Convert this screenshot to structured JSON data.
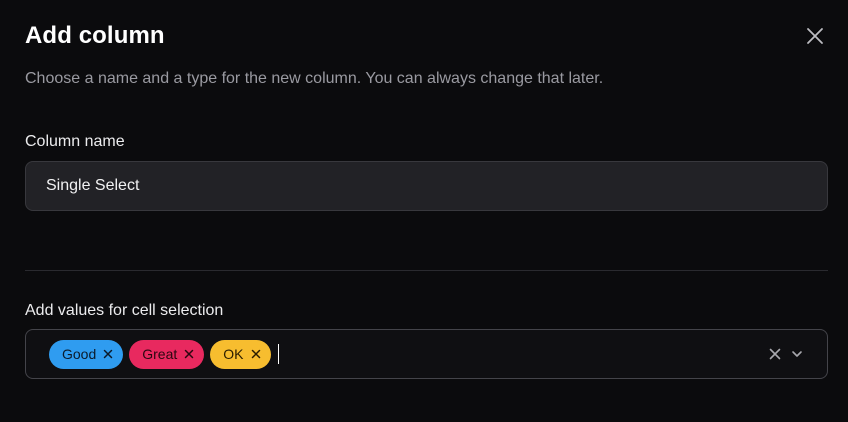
{
  "dialog": {
    "title": "Add column",
    "subtitle": "Choose a name and a type for the new column. You can always change that later.",
    "close_icon": "close-icon"
  },
  "column_name": {
    "label": "Column name",
    "value": "Single Select"
  },
  "cell_values": {
    "label": "Add values for cell selection",
    "chips": [
      {
        "label": "Good",
        "bg": "#2f9cf0",
        "fg": "#0b1a2a"
      },
      {
        "label": "Great",
        "bg": "#e8295f",
        "fg": "#2a0710"
      },
      {
        "label": "OK",
        "bg": "#f7bd2f",
        "fg": "#2a1d00"
      }
    ],
    "clear_icon": "clear-icon",
    "dropdown_icon": "chevron-down-icon"
  },
  "colors": {
    "background": "#0b0b0d",
    "input_bg": "#222226",
    "border": "#38383d",
    "muted_text": "#9a9aa1"
  }
}
